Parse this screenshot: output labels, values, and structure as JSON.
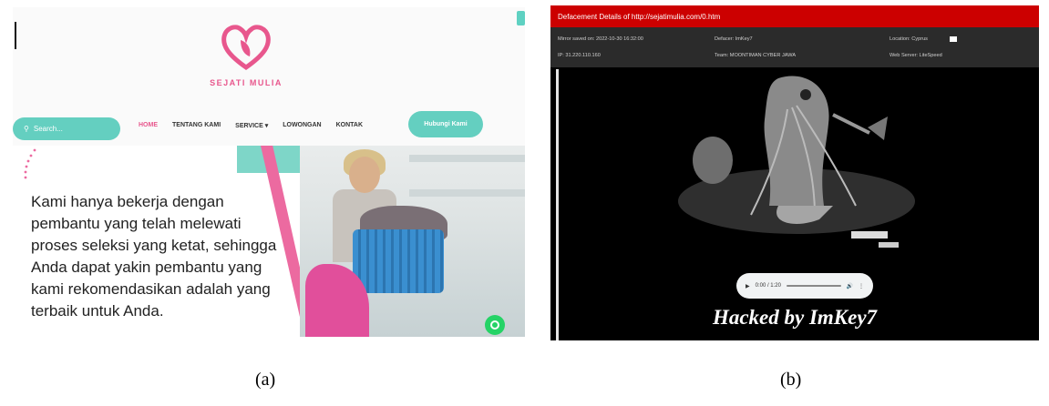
{
  "panel_a": {
    "brand_name": "SEJATI MULIA",
    "search_placeholder": "Search...",
    "nav": [
      "HOME",
      "TENTANG KAMI",
      "SERVICE ▾",
      "LOWONGAN",
      "KONTAK"
    ],
    "cta_label": "Hubungi Kami",
    "hero_text": "Kami hanya bekerja dengan pembantu yang telah melewati proses seleksi yang ketat, sehingga Anda dapat yakin pembantu yang kami rekomendasikan adalah yang terbaik untuk Anda.",
    "colors": {
      "teal": "#64cfc0",
      "pink": "#e8578d"
    }
  },
  "panel_b": {
    "title": "Defacement Details of http://sejatimulia.com/0.htm",
    "mirror_saved": "Mirror saved on: 2022-10-30 16:32:00",
    "ip": "IP: 31.220.110.160",
    "defacer": "Defacer: ImKey7",
    "team": "Team: MOONTIMAN CYBER JAWA",
    "location": "Location: Cyprus",
    "web_server": "Web Server: LiteSpeed",
    "audio_time": "0:00 / 1:20",
    "hacked_text": "Hacked by ImKey7",
    "colors": {
      "red_bar": "#cc0000",
      "info_bar": "#2b2b2b"
    }
  },
  "captions": {
    "a": "(a)",
    "b": "(b)"
  }
}
